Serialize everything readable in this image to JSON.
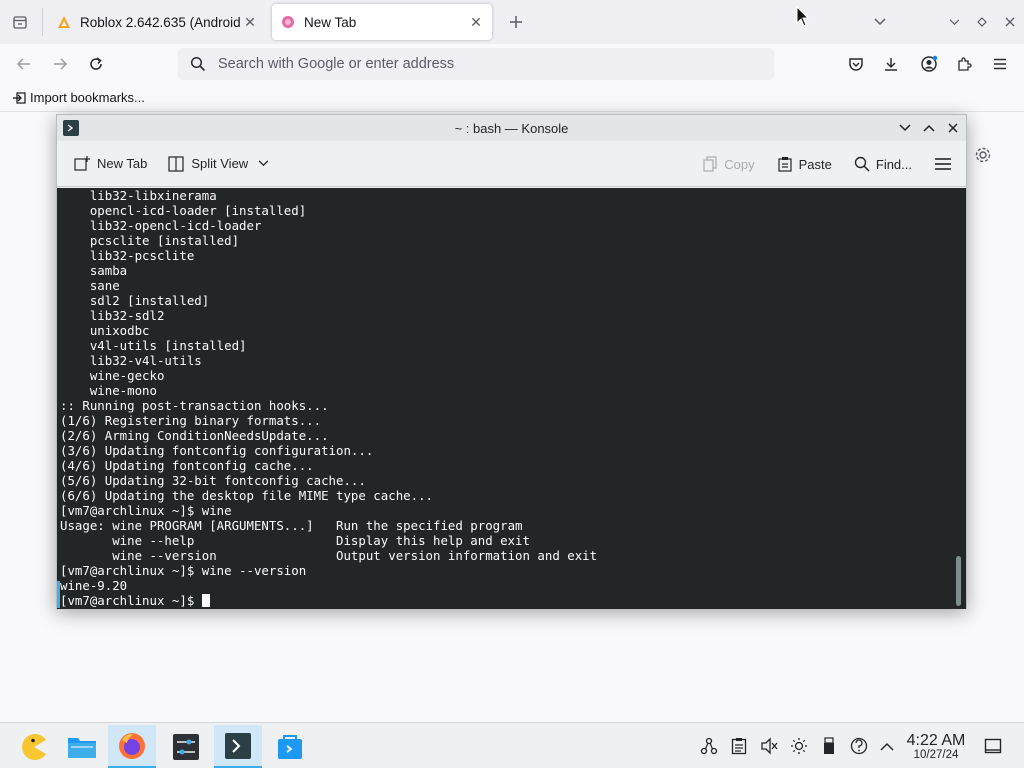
{
  "firefox": {
    "tabs": [
      {
        "title": "Roblox 2.642.635 (Android",
        "active": false
      },
      {
        "title": "New Tab",
        "active": true
      }
    ],
    "url_placeholder": "Search with Google or enter address",
    "bookmarks": {
      "import_label": "Import bookmarks..."
    }
  },
  "konsole": {
    "title": "~ : bash — Konsole",
    "toolbar": {
      "new_tab": "New Tab",
      "split_view": "Split View",
      "copy": "Copy",
      "paste": "Paste",
      "find": "Find..."
    },
    "lines": [
      "    lib32-libxinerama",
      "    opencl-icd-loader [installed]",
      "    lib32-opencl-icd-loader",
      "    pcsclite [installed]",
      "    lib32-pcsclite",
      "    samba",
      "    sane",
      "    sdl2 [installed]",
      "    lib32-sdl2",
      "    unixodbc",
      "    v4l-utils [installed]",
      "    lib32-v4l-utils",
      "    wine-gecko",
      "    wine-mono",
      ":: Running post-transaction hooks...",
      "(1/6) Registering binary formats...",
      "(2/6) Arming ConditionNeedsUpdate...",
      "(3/6) Updating fontconfig configuration...",
      "(4/6) Updating fontconfig cache...",
      "(5/6) Updating 32-bit fontconfig cache...",
      "(6/6) Updating the desktop file MIME type cache...",
      "[vm7@archlinux ~]$ wine",
      "Usage: wine PROGRAM [ARGUMENTS...]   Run the specified program",
      "       wine --help                   Display this help and exit",
      "       wine --version                Output version information and exit",
      "[vm7@archlinux ~]$ wine --version",
      "wine-9.20"
    ],
    "prompt": "[vm7@archlinux ~]$ "
  },
  "taskbar": {
    "apps": [
      "pacman-icon",
      "dolphin-icon",
      "firefox-icon",
      "settings-icon",
      "konsole-icon",
      "discover-icon"
    ],
    "clock": {
      "time": "4:22 AM",
      "date": "10/27/24"
    }
  },
  "colors": {
    "terminal_bg": "#232627",
    "terminal_fg": "#fcfcfc",
    "accent": "#3daee9"
  }
}
